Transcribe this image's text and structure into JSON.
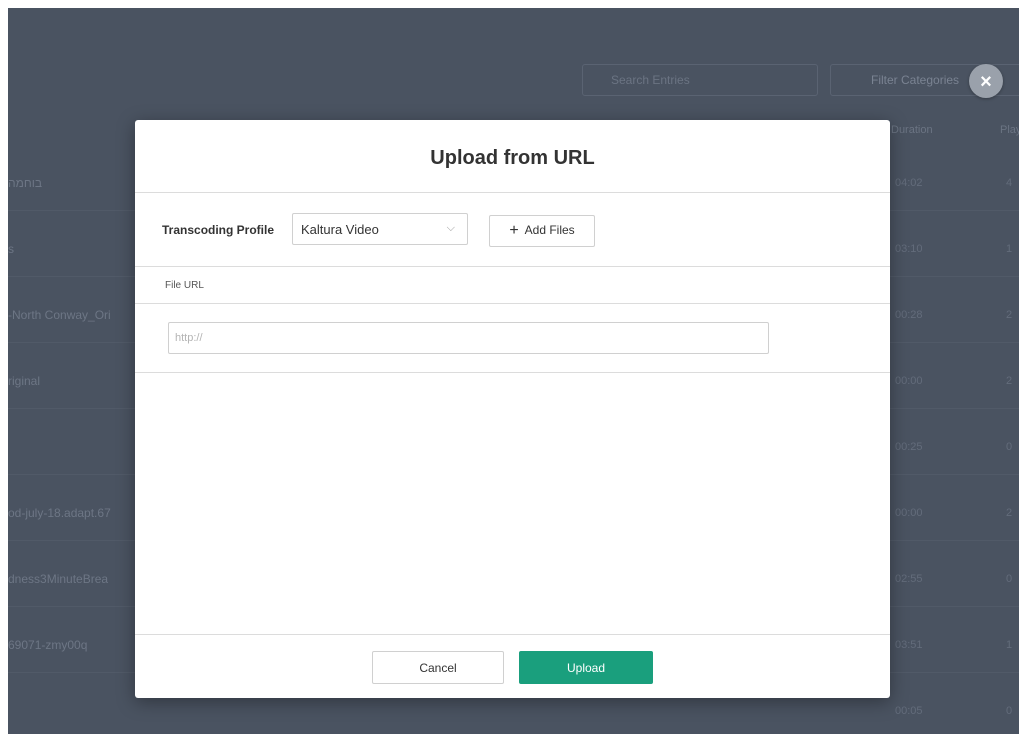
{
  "background": {
    "search_placeholder": "Search Entries",
    "filter_label": "Filter Categories",
    "columns": {
      "duration": "Duration",
      "plays": "Plays"
    },
    "rows": [
      {
        "name": "בוחמה",
        "duration": "04:02",
        "plays": "4"
      },
      {
        "name": "s",
        "duration": "03:10",
        "plays": "1"
      },
      {
        "name": "-North Conway_Ori",
        "duration": "00:28",
        "plays": "2"
      },
      {
        "name": "riginal",
        "duration": "00:00",
        "plays": "2"
      },
      {
        "name": "",
        "duration": "00:25",
        "plays": "0"
      },
      {
        "name": "od-july-18.adapt.67",
        "duration": "00:00",
        "plays": "2"
      },
      {
        "name": "dness3MinuteBrea",
        "duration": "02:55",
        "plays": "0"
      },
      {
        "name": "69071-zmy00q",
        "duration": "03:51",
        "plays": "1"
      },
      {
        "name": "",
        "duration": "00:05",
        "plays": "0"
      }
    ]
  },
  "close_label": "×",
  "modal": {
    "title": "Upload from URL",
    "transcoding_label": "Transcoding Profile",
    "transcoding_value": "Kaltura Video",
    "chevron": "⌵",
    "add_files_plus": "+",
    "add_files_label": "Add Files",
    "file_url_header": "File URL",
    "url_placeholder": "http://",
    "cancel_label": "Cancel",
    "upload_label": "Upload"
  },
  "colors": {
    "backdrop": "#4a5361",
    "primary": "#1a9f7d"
  }
}
